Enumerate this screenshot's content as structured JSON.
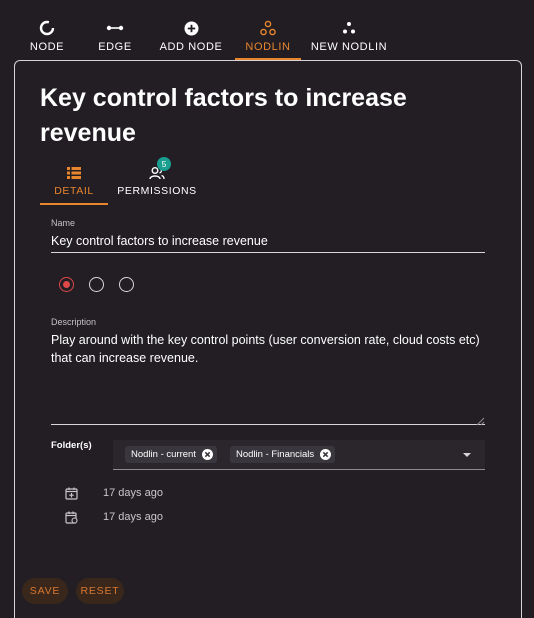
{
  "nav": {
    "items": [
      {
        "label": "NODE",
        "icon": "node-icon"
      },
      {
        "label": "EDGE",
        "icon": "edge-icon"
      },
      {
        "label": "ADD NODE",
        "icon": "add-node-icon"
      },
      {
        "label": "NODLIN",
        "icon": "nodlin-icon",
        "active": true
      },
      {
        "label": "NEW NODLIN",
        "icon": "new-nodlin-icon"
      }
    ]
  },
  "panel": {
    "title": "Key control factors to increase revenue",
    "tabs": [
      {
        "label": "DETAIL",
        "icon": "detail-list-icon",
        "active": true
      },
      {
        "label": "PERMISSIONS",
        "icon": "people-icon",
        "badge": "5"
      }
    ],
    "name": {
      "label": "Name",
      "value": "Key control factors to increase revenue"
    },
    "radios": {
      "selected_index": 0,
      "count": 3
    },
    "description": {
      "label": "Description",
      "value": "Play around with the key control points (user conversion rate, cloud costs etc) that can increase revenue."
    },
    "folders": {
      "label": "Folder(s)",
      "chips": [
        "Nodlin - current",
        "Nodlin - Financials"
      ]
    },
    "dates": {
      "created": "17 days ago",
      "updated": "17 days ago"
    },
    "buttons": {
      "save": "SAVE",
      "reset": "RESET"
    }
  },
  "colors": {
    "accent": "#e8852d",
    "background": "#211d23",
    "badge": "#1a9e8f",
    "radio_selected": "#e04848"
  }
}
